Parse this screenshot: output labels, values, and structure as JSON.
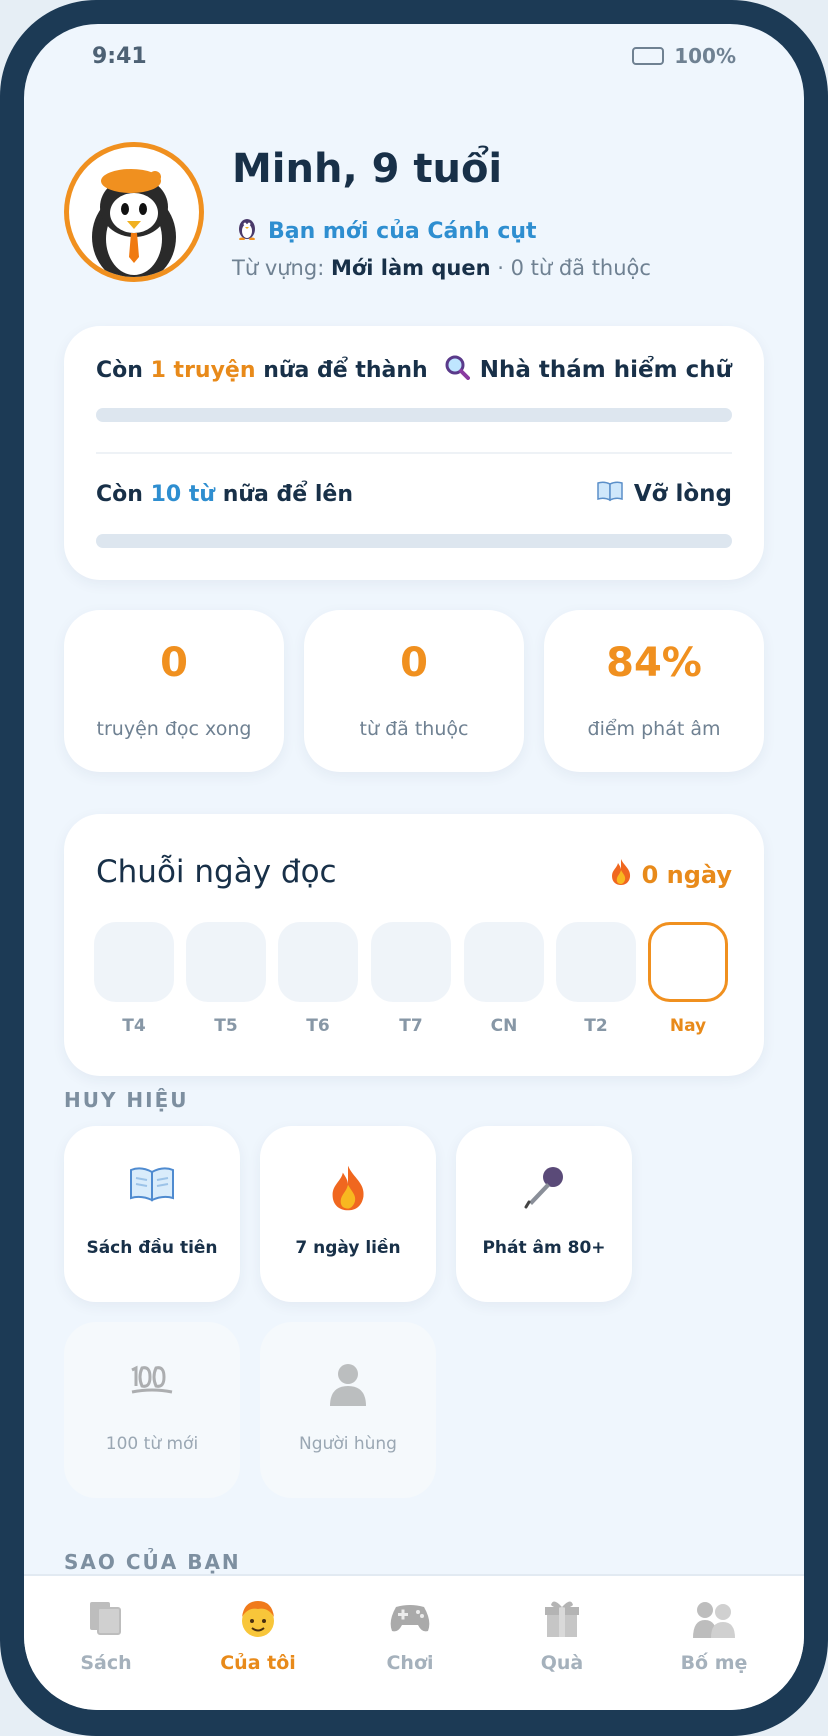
{
  "status_bar": {
    "time": "9:41",
    "battery": "100%"
  },
  "profile": {
    "name": "Minh, 9 tuổi",
    "friend_title": "Bạn mới của Cánh cụt",
    "vocab_prefix": "Từ vựng:",
    "vocab_level": "Mới làm quen",
    "vocab_suffix": "· 0 từ đã thuộc"
  },
  "progress": {
    "row1": {
      "pre": "Còn",
      "highlight": "1 truyện",
      "post": "nữa để thành",
      "target": "Nhà thám hiểm chữ",
      "fill_percent": 0
    },
    "row2": {
      "pre": "Còn",
      "highlight": "10 từ",
      "post": "nữa để lên",
      "target": "Vỡ lòng",
      "fill_percent": 0
    }
  },
  "stats": [
    {
      "value": "0",
      "label": "truyện đọc xong"
    },
    {
      "value": "0",
      "label": "từ đã thuộc"
    },
    {
      "value": "84%",
      "label": "điểm phát âm"
    }
  ],
  "streak": {
    "title": "Chuỗi ngày đọc",
    "count": "0 ngày",
    "days": [
      "T4",
      "T5",
      "T6",
      "T7",
      "CN",
      "T2",
      "Nay"
    ]
  },
  "badges_section": {
    "title": "HUY HIỆU",
    "badges": [
      {
        "label": "Sách đầu tiên",
        "icon": "open-book-icon",
        "unlocked": true
      },
      {
        "label": "7 ngày liền",
        "icon": "fire-icon",
        "unlocked": true
      },
      {
        "label": "Phát âm 80+",
        "icon": "microphone-icon",
        "unlocked": true
      },
      {
        "label": "100 từ mới",
        "icon": "hundred-points-icon",
        "unlocked": false
      },
      {
        "label": "Người hùng",
        "icon": "person-icon",
        "unlocked": false
      }
    ]
  },
  "stars_section": {
    "title": "SAO CỦA BẠN"
  },
  "nav": {
    "items": [
      {
        "label": "Sách",
        "icon": "books-icon"
      },
      {
        "label": "Của tôi",
        "icon": "child-face-icon",
        "active": true
      },
      {
        "label": "Chơi",
        "icon": "gamepad-icon"
      },
      {
        "label": "Quà",
        "icon": "gift-icon"
      },
      {
        "label": "Bố mẹ",
        "icon": "parents-icon"
      }
    ]
  },
  "colors": {
    "accent": "#f0901f",
    "link": "#2e8ed0",
    "text": "#183048",
    "frame": "#1c3a55"
  }
}
